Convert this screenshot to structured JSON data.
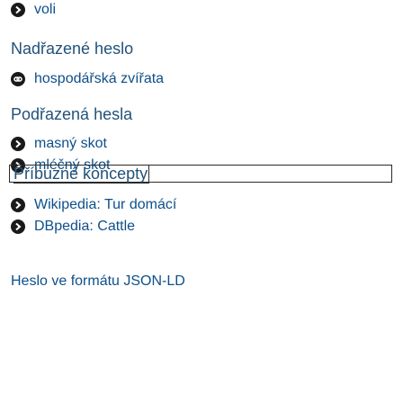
{
  "top_item": {
    "label": "voli",
    "icon": "external-link-circle-icon"
  },
  "broader": {
    "heading": "Nadřazené heslo",
    "items": [
      {
        "label": "hospodářská zvířata",
        "icon": "link-circle-icon"
      }
    ]
  },
  "narrower": {
    "heading": "Podřazená hesla",
    "items": [
      {
        "label": "masný skot",
        "icon": "arrow-circle-icon"
      },
      {
        "label": "mléčný skot",
        "icon": "arrow-circle-icon"
      }
    ]
  },
  "related": {
    "heading": "Příbuzné koncepty",
    "items": [
      {
        "label": "Wikipedia: Tur domácí",
        "icon": "arrow-circle-icon"
      },
      {
        "label": "DBpedia: Cattle",
        "icon": "arrow-circle-icon"
      }
    ]
  },
  "footer": {
    "label": "Heslo ve formátu JSON-LD"
  },
  "colors": {
    "link": "#0e4f8a",
    "heading": "#22527a",
    "icon": "#1a1a1a"
  }
}
